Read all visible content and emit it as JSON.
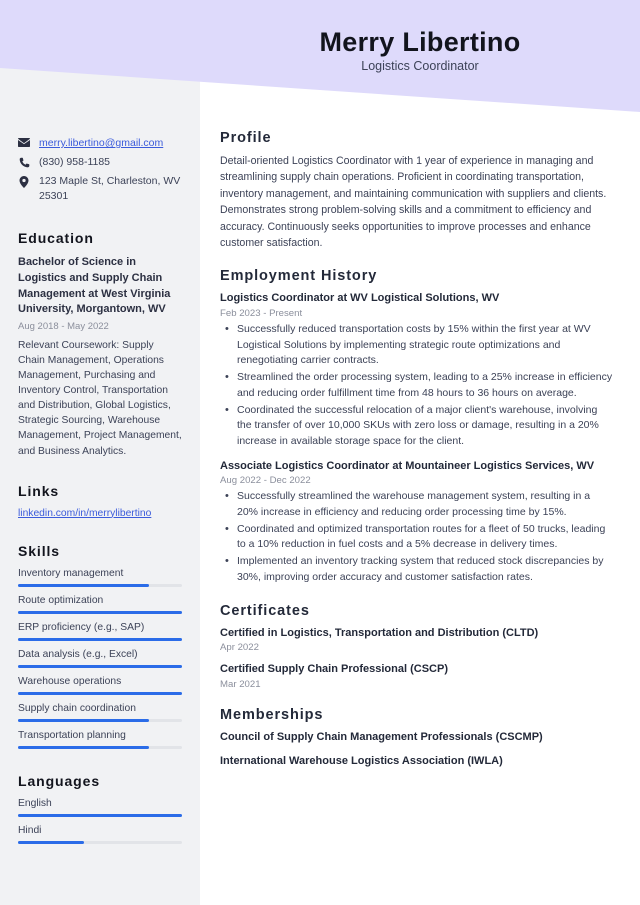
{
  "header": {
    "name": "Merry Libertino",
    "job_title": "Logistics Coordinator",
    "banner_color": "#DEDAFB"
  },
  "theme": {
    "accent": "#2B6CE8",
    "link": "#3B5BDB",
    "sidebar_bg": "#F1F2F4",
    "heading": "#232939"
  },
  "sidebar": {
    "contact": {
      "email": "merry.libertino@gmail.com",
      "phone": "(830) 958-1185",
      "address": "123 Maple St, Charleston, WV 25301",
      "icons": [
        "envelope-icon",
        "phone-icon",
        "location-pin-icon"
      ]
    },
    "education": {
      "heading": "Education",
      "items": [
        {
          "degree": "Bachelor of Science in Logistics and Supply Chain Management at West Virginia University, Morgantown, WV",
          "date": "Aug 2018 - May 2022",
          "description": "Relevant Coursework: Supply Chain Management, Operations Management, Purchasing and Inventory Control, Transportation and Distribution, Global Logistics, Strategic Sourcing, Warehouse Management, Project Management, and Business Analytics."
        }
      ]
    },
    "links": {
      "heading": "Links",
      "items": [
        {
          "label": "linkedin.com/in/merrylibertino"
        }
      ]
    },
    "skills": {
      "heading": "Skills",
      "items": [
        {
          "label": "Inventory management",
          "level": 80
        },
        {
          "label": "Route optimization",
          "level": 100
        },
        {
          "label": "ERP proficiency (e.g., SAP)",
          "level": 100
        },
        {
          "label": "Data analysis (e.g., Excel)",
          "level": 100
        },
        {
          "label": "Warehouse operations",
          "level": 100
        },
        {
          "label": "Supply chain coordination",
          "level": 80
        },
        {
          "label": "Transportation planning",
          "level": 80
        }
      ]
    },
    "languages": {
      "heading": "Languages",
      "items": [
        {
          "label": "English",
          "level": 100
        },
        {
          "label": "Hindi",
          "level": 40
        }
      ]
    }
  },
  "main": {
    "profile": {
      "heading": "Profile",
      "text": "Detail-oriented Logistics Coordinator with 1 year of experience in managing and streamlining supply chain operations. Proficient in coordinating transportation, inventory management, and maintaining communication with suppliers and clients. Demonstrates strong problem-solving skills and a commitment to efficiency and accuracy. Continuously seeks opportunities to improve processes and enhance customer satisfaction."
    },
    "employment": {
      "heading": "Employment History",
      "jobs": [
        {
          "title": "Logistics Coordinator at WV Logistical Solutions, WV",
          "date": "Feb 2023 - Present",
          "bullets": [
            "Successfully reduced transportation costs by 15% within the first year at WV Logistical Solutions by implementing strategic route optimizations and renegotiating carrier contracts.",
            "Streamlined the order processing system, leading to a 25% increase in efficiency and reducing order fulfillment time from 48 hours to 36 hours on average.",
            "Coordinated the successful relocation of a major client's warehouse, involving the transfer of over 10,000 SKUs with zero loss or damage, resulting in a 20% increase in available storage space for the client."
          ]
        },
        {
          "title": "Associate Logistics Coordinator at Mountaineer Logistics Services, WV",
          "date": "Aug 2022 - Dec 2022",
          "bullets": [
            "Successfully streamlined the warehouse management system, resulting in a 20% increase in efficiency and reducing order processing time by 15%.",
            "Coordinated and optimized transportation routes for a fleet of 50 trucks, leading to a 10% reduction in fuel costs and a 5% decrease in delivery times.",
            "Implemented an inventory tracking system that reduced stock discrepancies by 30%, improving order accuracy and customer satisfaction rates."
          ]
        }
      ]
    },
    "certificates": {
      "heading": "Certificates",
      "items": [
        {
          "title": "Certified in Logistics, Transportation and Distribution (CLTD)",
          "date": "Apr 2022"
        },
        {
          "title": "Certified Supply Chain Professional (CSCP)",
          "date": "Mar 2021"
        }
      ]
    },
    "memberships": {
      "heading": "Memberships",
      "items": [
        {
          "title": "Council of Supply Chain Management Professionals (CSCMP)"
        },
        {
          "title": "International Warehouse Logistics Association (IWLA)"
        }
      ]
    }
  }
}
